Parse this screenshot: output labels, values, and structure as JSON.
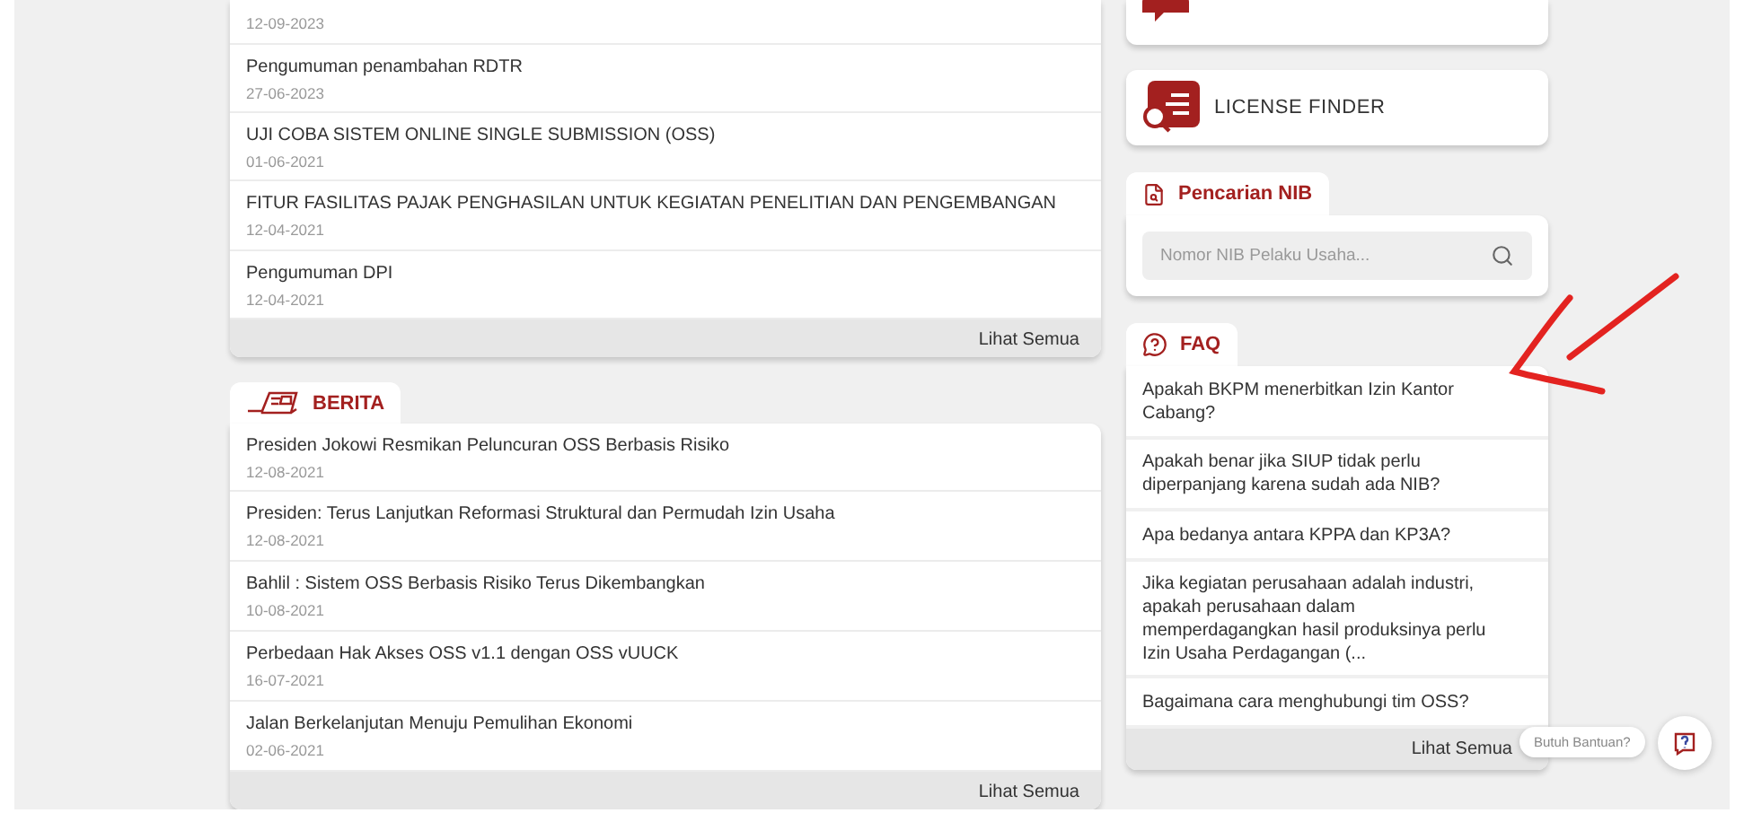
{
  "announcements": {
    "items": [
      {
        "date": "12-09-2023"
      },
      {
        "title": "Pengumuman penambahan RDTR",
        "date": "27-06-2023"
      },
      {
        "title": "UJI COBA SISTEM ONLINE SINGLE SUBMISSION (OSS)",
        "date": "01-06-2021"
      },
      {
        "title": "FITUR FASILITAS PAJAK PENGHASILAN UNTUK KEGIATAN PENELITIAN DAN PENGEMBANGAN",
        "date": "12-04-2021"
      },
      {
        "title": "Pengumuman DPI",
        "date": "12-04-2021"
      }
    ],
    "footer_link": "Lihat Semua"
  },
  "news": {
    "title": "BERITA",
    "items": [
      {
        "title": "Presiden Jokowi Resmikan Peluncuran OSS Berbasis Risiko",
        "date": "12-08-2021"
      },
      {
        "title": "Presiden: Terus Lanjutkan Reformasi Struktural dan Permudah Izin Usaha",
        "date": "12-08-2021"
      },
      {
        "title": "Bahlil : Sistem OSS Berbasis Risiko Terus Dikembangkan",
        "date": "10-08-2021"
      },
      {
        "title": "Perbedaan Hak Akses OSS v1.1 dengan OSS vUUCK",
        "date": "16-07-2021"
      },
      {
        "title": "Jalan Berkelanjutan Menuju Pemulihan Ekonomi",
        "date": "02-06-2021"
      }
    ],
    "footer_link": "Lihat Semua"
  },
  "license_finder": {
    "label": "LICENSE FINDER"
  },
  "nib_search": {
    "title": "Pencarian NIB",
    "placeholder": "Nomor NIB Pelaku Usaha..."
  },
  "faq": {
    "title": "FAQ",
    "items": [
      "Apakah BKPM menerbitkan Izin Kantor Cabang?",
      "Apakah benar jika SIUP tidak perlu diperpanjang karena sudah ada NIB?",
      "Apa bedanya antara KPPA dan KP3A?",
      "Jika kegiatan perusahaan adalah industri, apakah perusahaan dalam memperdagangkan hasil produksinya perlu Izin Usaha Perdagangan (...",
      "Bagaimana cara menghubungi tim OSS?"
    ],
    "footer_link": "Lihat Semua"
  },
  "help": {
    "tooltip": "Butuh Bantuan?"
  }
}
